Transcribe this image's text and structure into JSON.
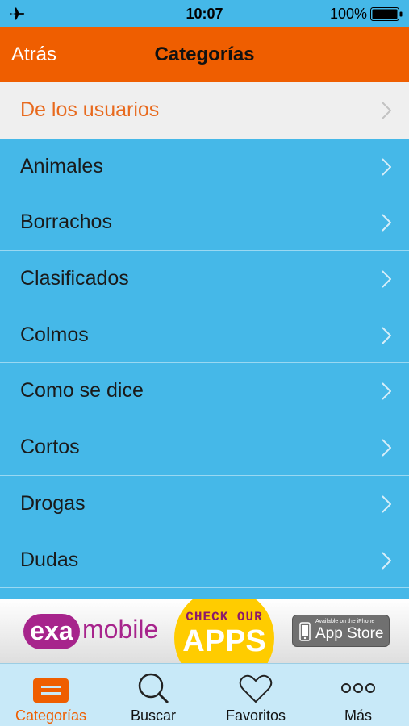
{
  "status_bar": {
    "time": "10:07",
    "battery": "100%"
  },
  "nav": {
    "back_label": "Atrás",
    "title": "Categorías"
  },
  "list": {
    "items": [
      {
        "label": "De los usuarios"
      },
      {
        "label": "Animales"
      },
      {
        "label": "Borrachos"
      },
      {
        "label": "Clasificados"
      },
      {
        "label": "Colmos"
      },
      {
        "label": "Como se dice"
      },
      {
        "label": "Cortos"
      },
      {
        "label": "Drogas"
      },
      {
        "label": "Dudas"
      }
    ]
  },
  "ad": {
    "logo_exa": "exa",
    "logo_mobile": "mobile",
    "check_text": "CHECK OUR",
    "apps_text": "APPS",
    "badge_small": "Available on the iPhone",
    "badge_big": "App Store"
  },
  "tabs": [
    {
      "label": "Categorías",
      "icon": "categories-icon"
    },
    {
      "label": "Buscar",
      "icon": "search-icon"
    },
    {
      "label": "Favoritos",
      "icon": "heart-icon"
    },
    {
      "label": "Más",
      "icon": "more-icon"
    }
  ],
  "colors": {
    "nav_orange": "#ef5e00",
    "list_blue": "#45b8e8",
    "highlight_text": "#e86a1e",
    "tab_bar_bg": "#c8e9f8",
    "exa_purple": "#a7248c",
    "apps_yellow": "#ffcc00"
  }
}
